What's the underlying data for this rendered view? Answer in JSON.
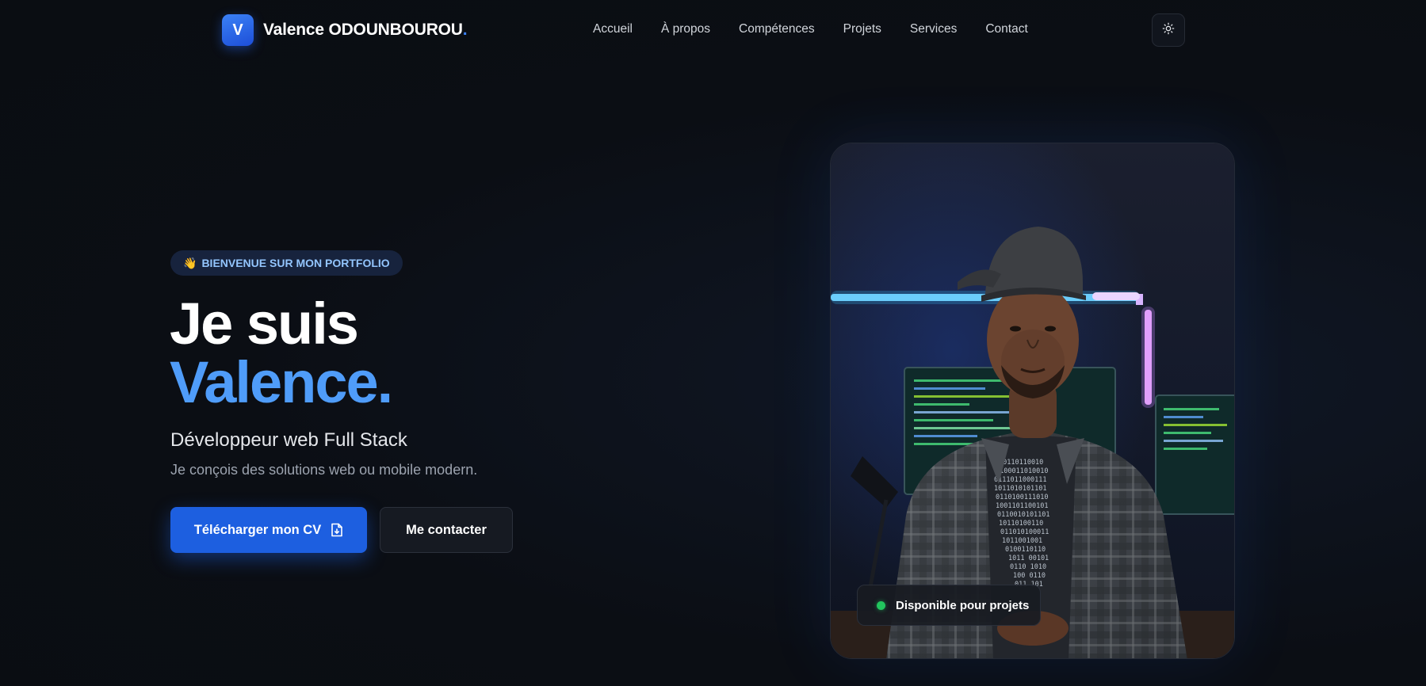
{
  "header": {
    "logo_letter": "V",
    "logo_name": "Valence ODOUNBOUROU",
    "logo_dot": ".",
    "nav": [
      {
        "label": "Accueil"
      },
      {
        "label": "À propos"
      },
      {
        "label": "Compétences"
      },
      {
        "label": "Projets"
      },
      {
        "label": "Services"
      },
      {
        "label": "Contact"
      }
    ],
    "theme_toggle_icon": "sun-icon"
  },
  "hero": {
    "badge_emoji": "👋",
    "badge_text": "BIENVENUE SUR MON PORTFOLIO",
    "title_line1": "Je suis",
    "title_line2": "Valence.",
    "subtitle": "Développeur web Full Stack",
    "tagline": "Je conçois des solutions web ou mobile modern.",
    "primary_button": {
      "label": "Télécharger mon CV",
      "icon": "file-download-icon"
    },
    "secondary_button": {
      "label": "Me contacter"
    },
    "status": {
      "label": "Disponible pour projets"
    }
  },
  "colors": {
    "background": "#0b0e14",
    "accent": "#4f9cf9",
    "primary_button": "#1d5fe0",
    "status_dot": "#22c55e",
    "badge_text": "#93c5fd"
  }
}
